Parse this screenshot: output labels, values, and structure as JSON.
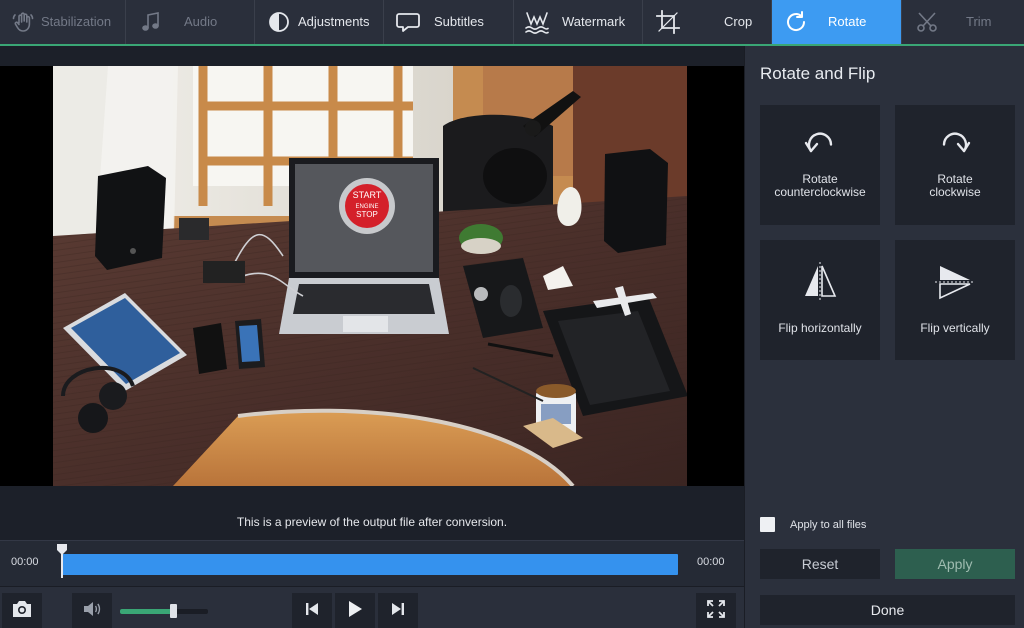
{
  "toolbar": {
    "tabs": [
      {
        "key": "stabilization",
        "label": "Stabilization",
        "icon": "hand-icon",
        "state": "disabled"
      },
      {
        "key": "audio",
        "label": "Audio",
        "icon": "music-note-icon",
        "state": "disabled"
      },
      {
        "key": "adjustments",
        "label": "Adjustments",
        "icon": "contrast-icon",
        "state": "normal"
      },
      {
        "key": "subtitles",
        "label": "Subtitles",
        "icon": "speech-bubble-icon",
        "state": "normal"
      },
      {
        "key": "watermark",
        "label": "Watermark",
        "icon": "watermark-icon",
        "state": "normal"
      },
      {
        "key": "crop",
        "label": "Crop",
        "icon": "crop-icon",
        "state": "normal"
      },
      {
        "key": "rotate",
        "label": "Rotate",
        "icon": "rotate-icon",
        "state": "active"
      },
      {
        "key": "trim",
        "label": "Trim",
        "icon": "scissors-icon",
        "state": "disabled"
      }
    ]
  },
  "preview": {
    "note": "This is a preview of the output file after conversion.",
    "photo_labels": {
      "start": "START",
      "engine": "ENGINE",
      "stop": "STOP"
    }
  },
  "timeline": {
    "current_time": "00:00",
    "total_time": "00:00",
    "progress": 0
  },
  "controls": {
    "volume": 0.6,
    "icons": [
      "camera-icon",
      "speaker-icon",
      "skip-back-icon",
      "play-icon",
      "skip-forward-icon",
      "fullscreen-icon"
    ]
  },
  "panel": {
    "title": "Rotate and Flip",
    "tiles": {
      "ccw": {
        "line1": "Rotate",
        "line2": "counterclockwise",
        "icon": "rotate-ccw-icon"
      },
      "cw": {
        "line1": "Rotate",
        "line2": "clockwise",
        "icon": "rotate-cw-icon"
      },
      "flip_h": {
        "label": "Flip horizontally",
        "icon": "flip-horizontal-icon"
      },
      "flip_v": {
        "label": "Flip vertically",
        "icon": "flip-vertical-icon"
      }
    },
    "apply_all_label": "Apply to all files",
    "apply_all_checked": false,
    "reset_label": "Reset",
    "apply_label": "Apply",
    "done_label": "Done"
  },
  "colors": {
    "accent_blue": "#3d9bf2",
    "accent_green": "#3aa675",
    "apply_button": "#2d5f4f",
    "panel_bg": "#2b303c"
  }
}
